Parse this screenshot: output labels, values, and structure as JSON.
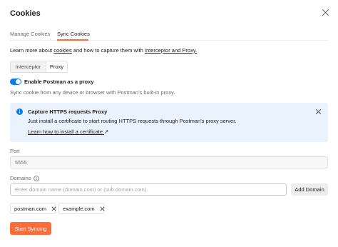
{
  "dialog": {
    "title": "Cookies",
    "close_icon": "close-icon"
  },
  "tabs": [
    {
      "label": "Manage Cookies",
      "active": false
    },
    {
      "label": "Sync Cookies",
      "active": true
    }
  ],
  "learn_more": {
    "prefix": "Learn more about ",
    "cookies_link": "cookies",
    "middle": " and how to capture them with ",
    "interceptor_link": "Interceptor and Proxy."
  },
  "segmented": {
    "interceptor": "Interceptor",
    "proxy": "Proxy",
    "selected": "Proxy"
  },
  "proxy_toggle": {
    "label": "Enable Postman as a proxy",
    "enabled": true,
    "description": "Sync cookie from any device or browser with Postman's built-in proxy."
  },
  "info_banner": {
    "icon": "info-icon",
    "title": "Capture HTTPS requests Proxy",
    "text": "Just install a certificate to start routing HTTPS requests through Postman's proxy server.",
    "link": "Learn how to install a certificate",
    "link_arrow": "↗",
    "close_icon": "close-icon"
  },
  "port": {
    "label": "Port",
    "placeholder": "5555"
  },
  "domains": {
    "label": "Domains",
    "placeholder": "Enter domain name (domain.com) or (sub.domain.com).",
    "add_button": "Add Domain",
    "chips": [
      "postman.com",
      "example.com"
    ]
  },
  "start_button": "Start Syncing",
  "colors": {
    "accent": "#ff6c37",
    "toggle": "#097bed",
    "info_bg": "#eaf2fd"
  }
}
